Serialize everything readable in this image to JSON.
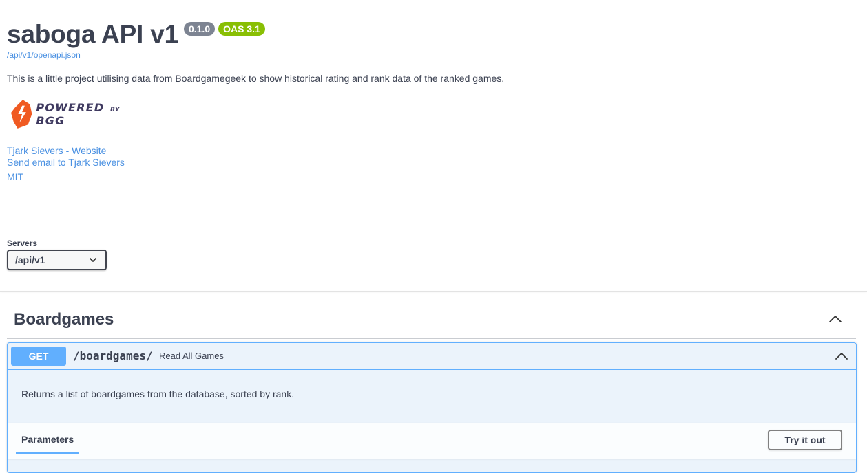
{
  "info": {
    "title": "saboga API v1",
    "version_badge": "0.1.0",
    "oas_badge": "OAS 3.1",
    "spec_link": "/api/v1/openapi.json",
    "description": "This is a little project utilising data from Boardgamegeek to show historical rating and rank data of the ranked games.",
    "logo": {
      "icon": "bgg-flame-logo",
      "text_main": "POWERED",
      "text_by": "BY",
      "text_brand": "BGG"
    },
    "contact_website": "Tjark Sievers - Website",
    "contact_email": "Send email to Tjark Sievers",
    "license": "MIT"
  },
  "servers": {
    "label": "Servers",
    "selected": "/api/v1"
  },
  "tag": {
    "title": "Boardgames",
    "expanded": true
  },
  "operation": {
    "method": "GET",
    "path": "/boardgames/",
    "summary": "Read All Games",
    "description": "Returns a list of boardgames from the database, sorted by rank.",
    "params_tab": "Parameters",
    "try_button": "Try it out",
    "expanded": true
  },
  "colors": {
    "link": "#4990e2",
    "get_method": "#61affe",
    "get_bg": "#ebf3fb",
    "version_badge": "#7d8492",
    "oas_badge": "#89bf04",
    "text": "#3b4151",
    "logo_flame": "#f05a22",
    "logo_text": "#3f3a60"
  },
  "icons": {
    "servers_chevron": "chevron-down-icon",
    "tag_toggle": "chevron-up-icon",
    "op_toggle": "chevron-up-icon"
  }
}
